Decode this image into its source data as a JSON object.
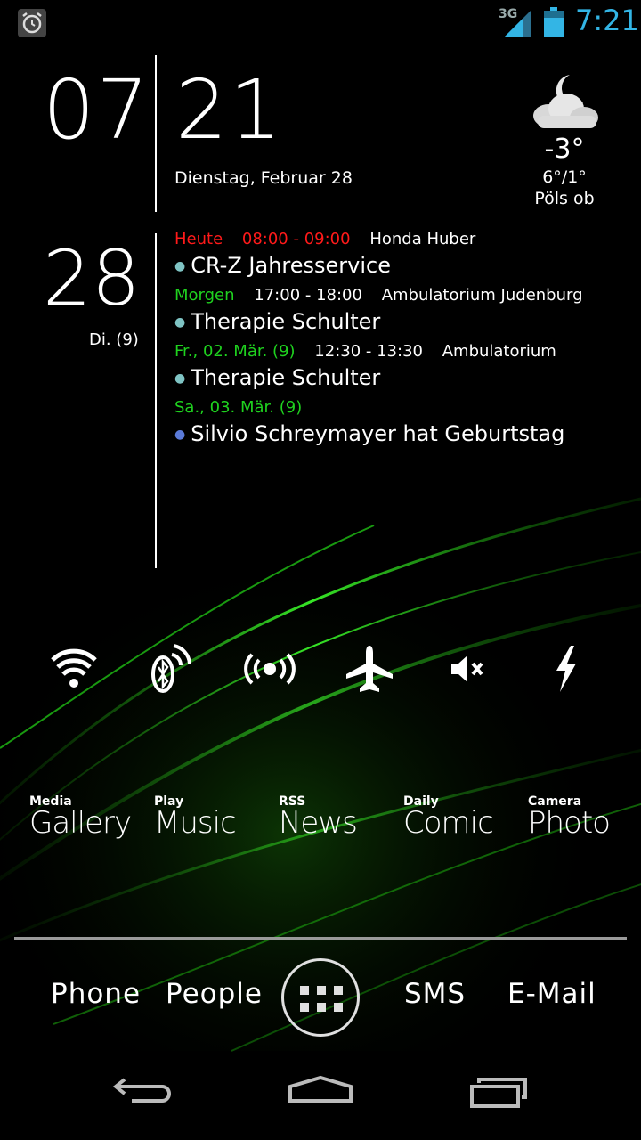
{
  "status_bar": {
    "time": "7:21",
    "network": "3G",
    "alarm_icon": "alarm-icon",
    "accent_color": "#33b5e5"
  },
  "clock": {
    "hour": "07",
    "minute": "21",
    "date": "Dienstag, Februar 28"
  },
  "weather": {
    "icon": "moon-cloud-icon",
    "temperature": "-3°",
    "range": "6°/1°",
    "location": "Pöls ob"
  },
  "calendar": {
    "day": "28",
    "weekday_week": "Di. (9)",
    "events": [
      {
        "day_label": "Heute",
        "day_color": "red",
        "time": "08:00 - 09:00",
        "time_color": "red",
        "location": "Honda Huber",
        "title": "CR-Z Jahresservice",
        "bullet_color": "#7fc4c4"
      },
      {
        "day_label": "Morgen",
        "day_color": "green",
        "time": "17:00 - 18:00",
        "time_color": "white",
        "location": "Ambulatorium Judenburg",
        "title": "Therapie Schulter",
        "bullet_color": "#7fc4c4"
      },
      {
        "day_label": "Fr., 02. Mär. (9)",
        "day_color": "green",
        "time": "12:30 - 13:30",
        "time_color": "white",
        "location": "Ambulatorium",
        "title": "Therapie Schulter",
        "bullet_color": "#7fc4c4"
      },
      {
        "day_label": "Sa., 03. Mär. (9)",
        "day_color": "green",
        "time": "",
        "time_color": "white",
        "location": "",
        "title": "Silvio Schreymayer hat Geburtstag",
        "bullet_color": "#5a7ad8"
      }
    ]
  },
  "toggles": [
    {
      "icon": "wifi-icon"
    },
    {
      "icon": "bluetooth-icon"
    },
    {
      "icon": "hotspot-icon"
    },
    {
      "icon": "airplane-icon"
    },
    {
      "icon": "mute-icon"
    },
    {
      "icon": "flash-icon"
    }
  ],
  "shortcuts": [
    {
      "small": "Media",
      "big": "Gallery"
    },
    {
      "small": "Play",
      "big": "Music"
    },
    {
      "small": "RSS",
      "big": "News"
    },
    {
      "small": "Daily",
      "big": "Comic"
    },
    {
      "small": "Camera",
      "big": "Photo"
    }
  ],
  "dock": {
    "phone": "Phone",
    "people": "People",
    "apps_icon": "app-drawer-icon",
    "sms": "SMS",
    "email": "E-Mail"
  },
  "nav": {
    "back_icon": "back-icon",
    "home_icon": "home-icon",
    "recents_icon": "recents-icon"
  }
}
